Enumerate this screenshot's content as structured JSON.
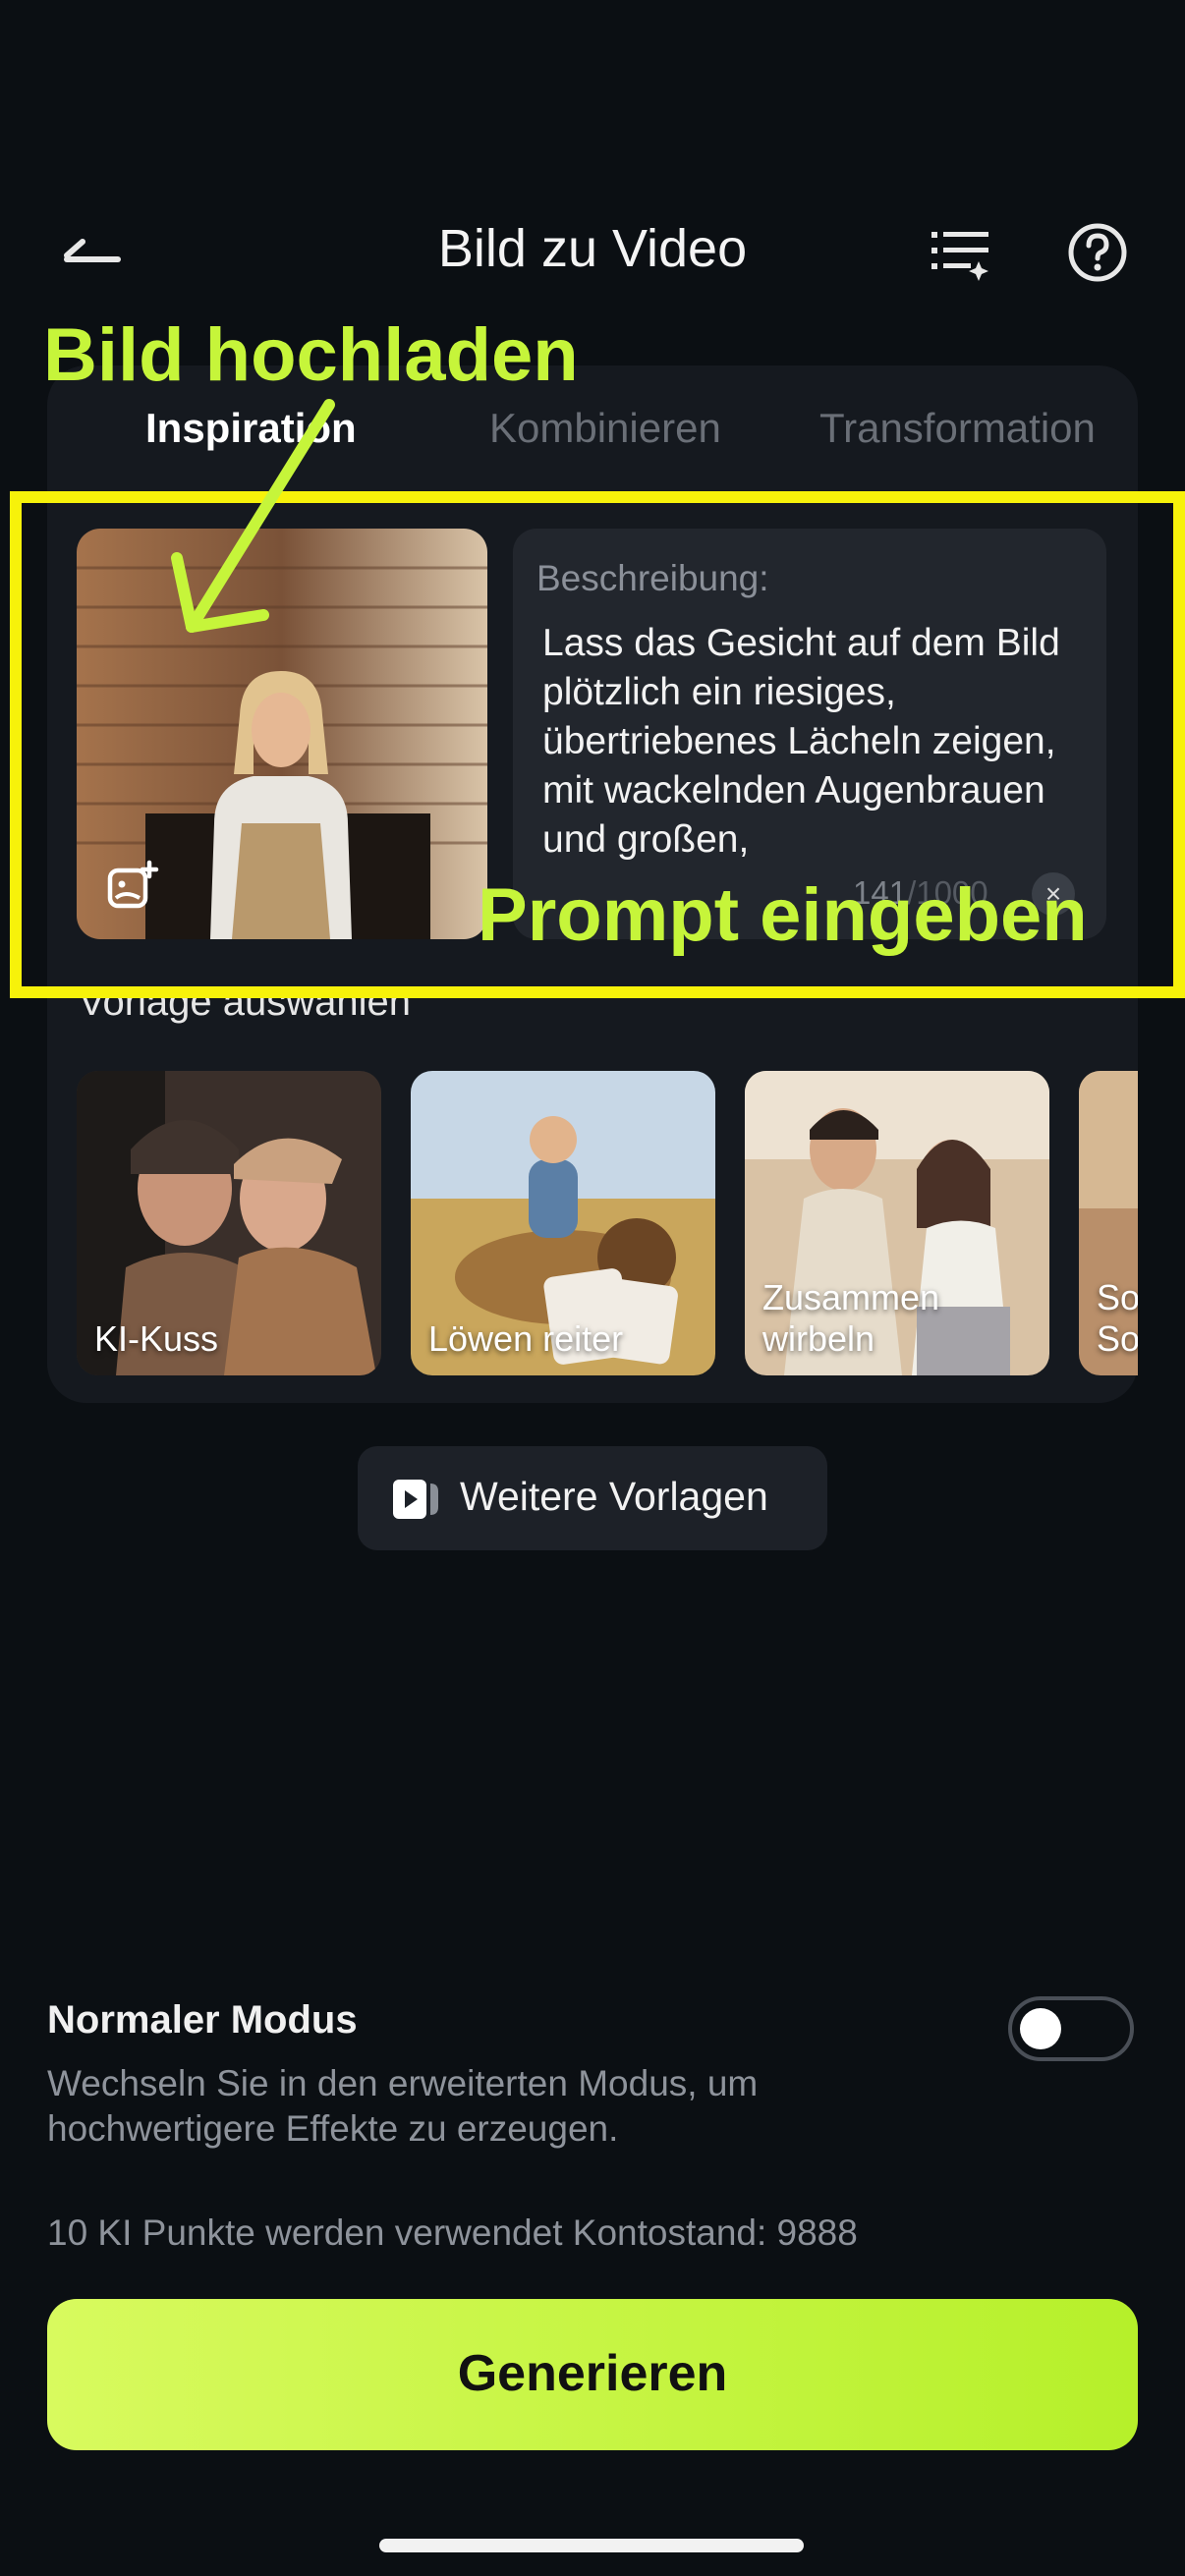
{
  "header": {
    "title": "Bild zu Video"
  },
  "tabs": [
    {
      "label": "Inspiration",
      "active": true
    },
    {
      "label": "Kombinieren",
      "active": false
    },
    {
      "label": "Transformation",
      "active": false
    }
  ],
  "description": {
    "label": "Beschreibung:",
    "text": "Lass das Gesicht auf dem Bild plötzlich ein riesiges, übertriebenes Lächeln zeigen, mit wackelnden Augenbrauen und großen,",
    "count": "141",
    "max": "/1000",
    "clear_symbol": "×"
  },
  "templates": {
    "section_label": "Vorlage auswählen",
    "items": [
      {
        "label": "KI-Kuss"
      },
      {
        "label": "Löwen reiter"
      },
      {
        "label": "Zusammen wirbeln"
      },
      {
        "label": "So So"
      }
    ],
    "more_label": "Weitere Vorlagen"
  },
  "annotations": {
    "upload": "Bild hochladen",
    "prompt": "Prompt eingeben",
    "highlight_color": "#f7f20a",
    "text_color": "#c6f53a"
  },
  "mode": {
    "title": "Normaler Modus",
    "description": "Wechseln Sie in den erweiterten Modus, um hochwertigere Effekte zu erzeugen.",
    "enabled": false
  },
  "points_text": "10 KI Punkte werden verwendet Kontostand: 9888",
  "generate_label": "Generieren",
  "colors": {
    "background": "#0b0f13",
    "accent": "#c8f73d"
  }
}
